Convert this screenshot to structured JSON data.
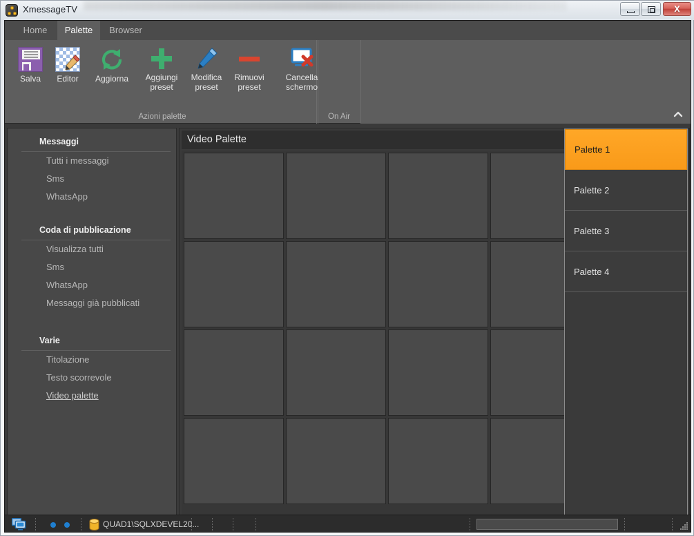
{
  "window": {
    "title": "XmessageTV",
    "app_icon": "app-nodes-icon",
    "controls": {
      "minimize_label": "Minimize",
      "maximize_label": "Maximize",
      "close_label": "X"
    }
  },
  "ribbon": {
    "tabs": [
      {
        "id": "home",
        "label": "Home",
        "active": false
      },
      {
        "id": "palette",
        "label": "Palette",
        "active": true
      },
      {
        "id": "browser",
        "label": "Browser",
        "active": false
      }
    ],
    "groups": [
      {
        "id": "azioni-palette",
        "label": "Azioni palette",
        "buttons": [
          {
            "id": "salva",
            "label": "Salva",
            "icon": "floppy-disk-icon",
            "color": "#8b5fae"
          },
          {
            "id": "editor",
            "label": "Editor",
            "icon": "checkerboard-pencil-icon",
            "color": "#9fbbe4"
          },
          {
            "id": "aggiorna",
            "label": "Aggiorna",
            "icon": "refresh-circular-arrow-icon",
            "color": "#3fae6f"
          },
          {
            "id": "aggiungi",
            "label": "Aggiungi\npreset",
            "line1": "Aggiungi",
            "line2": "preset",
            "icon": "plus-icon",
            "color": "#3fae6f"
          },
          {
            "id": "modifica",
            "label": "Modifica\npreset",
            "line1": "Modifica",
            "line2": "preset",
            "icon": "pencil-icon",
            "color": "#2b7fc4"
          },
          {
            "id": "rimuovi",
            "label": "Rimuovi\npreset",
            "line1": "Rimuovi",
            "line2": "preset",
            "icon": "minus-icon",
            "color": "#d9452f"
          }
        ]
      },
      {
        "id": "on-air",
        "label": "On Air",
        "buttons": [
          {
            "id": "cancella-schermo",
            "line1": "Cancella",
            "line2": "schermo",
            "icon": "monitor-clear-icon",
            "color": "#2b7fc4"
          }
        ]
      }
    ],
    "collapse_icon": "chevron-up-icon"
  },
  "sidebar": {
    "sections": [
      {
        "id": "messaggi",
        "heading": "Messaggi",
        "items": [
          {
            "id": "tutti-i-messaggi",
            "label": "Tutti i messaggi",
            "active": false
          },
          {
            "id": "sms",
            "label": "Sms",
            "active": false
          },
          {
            "id": "whatsapp",
            "label": "WhatsApp",
            "active": false
          }
        ]
      },
      {
        "id": "coda-di-pubblicazione",
        "heading": "Coda di pubblicazione",
        "items": [
          {
            "id": "visualizza-tutti",
            "label": "Visualizza tutti",
            "active": false
          },
          {
            "id": "coda-sms",
            "label": "Sms",
            "active": false
          },
          {
            "id": "coda-whatsapp",
            "label": "WhatsApp",
            "active": false
          },
          {
            "id": "messaggi-gia-pubblicati",
            "label": "Messaggi già pubblicati",
            "active": false
          }
        ]
      },
      {
        "id": "varie",
        "heading": "Varie",
        "items": [
          {
            "id": "titolazione",
            "label": "Titolazione",
            "active": false
          },
          {
            "id": "testo-scorrevole",
            "label": "Testo scorrevole",
            "active": false
          },
          {
            "id": "video-palette",
            "label": "Video palette",
            "active": true
          }
        ]
      }
    ]
  },
  "main": {
    "panel_title": "Video Palette",
    "grid": {
      "rows": 4,
      "columns": 4,
      "cells": [
        {
          "id": "cell-1-1",
          "content": ""
        },
        {
          "id": "cell-1-2",
          "content": ""
        },
        {
          "id": "cell-1-3",
          "content": ""
        },
        {
          "id": "cell-1-4",
          "content": ""
        },
        {
          "id": "cell-2-1",
          "content": ""
        },
        {
          "id": "cell-2-2",
          "content": ""
        },
        {
          "id": "cell-2-3",
          "content": ""
        },
        {
          "id": "cell-2-4",
          "content": ""
        },
        {
          "id": "cell-3-1",
          "content": ""
        },
        {
          "id": "cell-3-2",
          "content": ""
        },
        {
          "id": "cell-3-3",
          "content": ""
        },
        {
          "id": "cell-3-4",
          "content": ""
        },
        {
          "id": "cell-4-1",
          "content": ""
        },
        {
          "id": "cell-4-2",
          "content": ""
        },
        {
          "id": "cell-4-3",
          "content": ""
        },
        {
          "id": "cell-4-4",
          "content": ""
        }
      ]
    }
  },
  "preset_list": {
    "selected_id": "palette-1",
    "selected_color": "#ffa727",
    "items": [
      {
        "id": "palette-1",
        "label": "Palette 1",
        "selected": true
      },
      {
        "id": "palette-2",
        "label": "Palette 2",
        "selected": false
      },
      {
        "id": "palette-3",
        "label": "Palette 3",
        "selected": false
      },
      {
        "id": "palette-4",
        "label": "Palette 4",
        "selected": false
      }
    ]
  },
  "status_bar": {
    "monitor_icon": "dual-monitor-icon",
    "indicator_dots": 2,
    "indicator_color": "#1f7fd0",
    "database_icon": "database-cylinder-icon",
    "database_text": "QUAD1\\SQLXDEVEL20...",
    "progress_value": 0,
    "resize_grip_icon": "resize-grip-icon"
  }
}
